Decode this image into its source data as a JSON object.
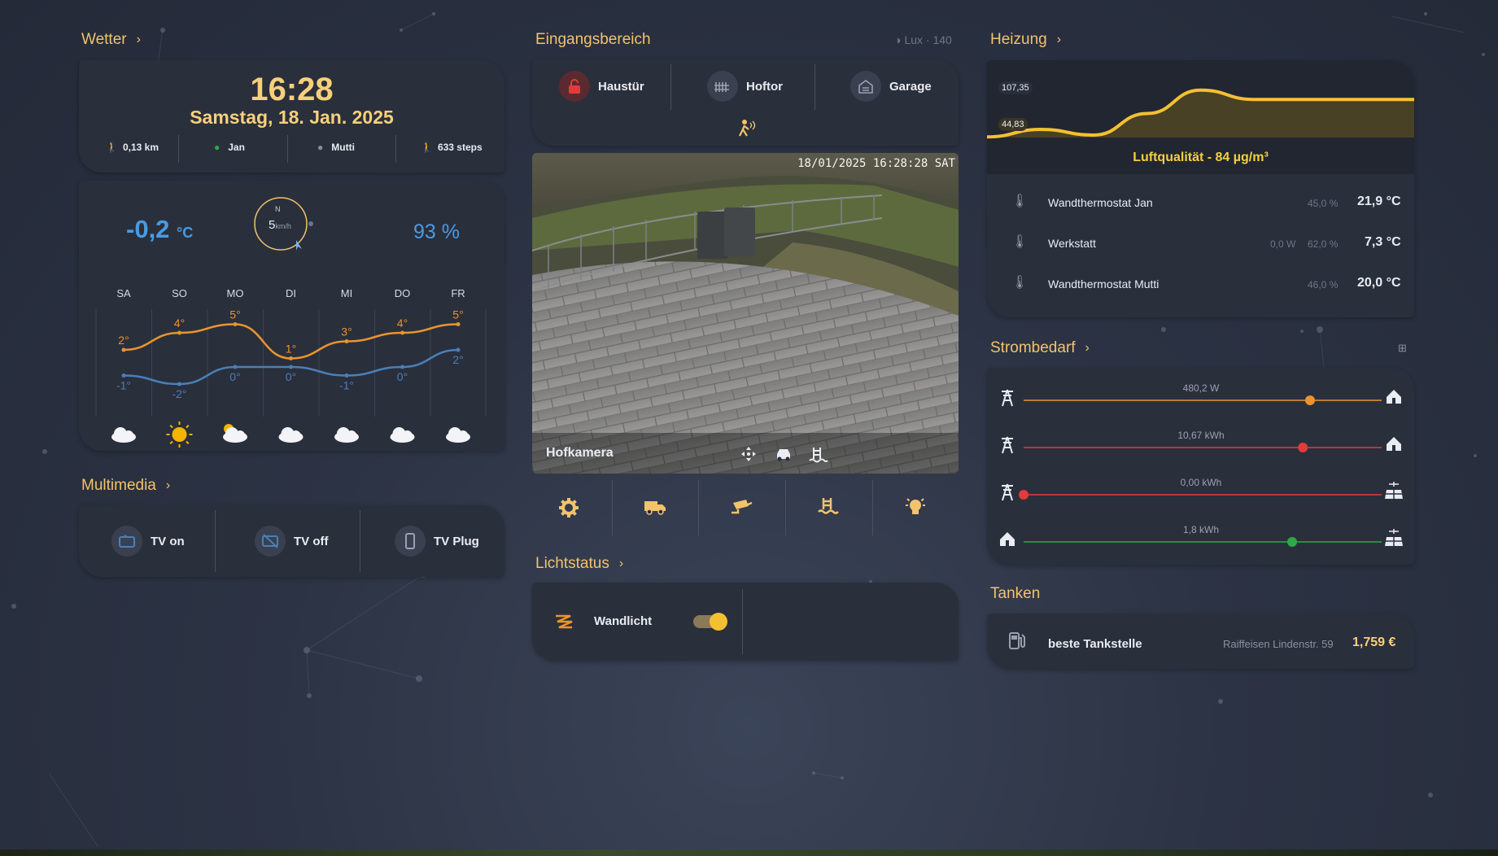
{
  "weather": {
    "section_title": "Wetter",
    "time": "16:28",
    "date": "Samstag, 18. Jan. 2025",
    "stats": [
      {
        "icon": "walking-icon",
        "label": "0,13 km"
      },
      {
        "icon": "person-icon",
        "label": "Jan",
        "color": "#2ea84a"
      },
      {
        "icon": "person-icon",
        "label": "Mutti",
        "color": "#8a8f99"
      },
      {
        "icon": "walking-icon",
        "label": "633 steps"
      }
    ],
    "temperature": "-0,2",
    "temperature_unit": "°C",
    "wind_speed": "5",
    "wind_unit": "km/h",
    "compass_n": "N",
    "humidity": "93 %",
    "chart_data": {
      "type": "line",
      "categories": [
        "SA",
        "SO",
        "MO",
        "DI",
        "MI",
        "DO",
        "FR"
      ],
      "series": [
        {
          "values": [
            2,
            4,
            5,
            1,
            3,
            4,
            5
          ],
          "color": "#e8952e"
        },
        {
          "values": [
            -1,
            -2,
            0,
            0,
            -1,
            0,
            2
          ],
          "color": "#4a7fb8"
        }
      ],
      "high_labels": [
        "2°",
        "4°",
        "5°",
        "1°",
        "3°",
        "4°",
        "5°"
      ],
      "low_labels": [
        "-1°",
        "-2°",
        "0°",
        "0°",
        "-1°",
        "0°",
        "2°"
      ],
      "icons": [
        "cloud-icon",
        "sun-icon",
        "partly-cloudy-icon",
        "cloud-icon",
        "cloud-icon",
        "cloud-icon",
        "cloud-icon"
      ]
    }
  },
  "multimedia": {
    "section_title": "Multimedia",
    "items": [
      {
        "icon": "tv-icon",
        "label": "TV on",
        "icon_color": "#4a7fb8"
      },
      {
        "icon": "tv-off-icon",
        "label": "TV off",
        "icon_color": "#4a7fb8"
      },
      {
        "icon": "phone-icon",
        "label": "TV Plug",
        "icon_color": "#9aa1ad"
      }
    ]
  },
  "entrance": {
    "section_title": "Eingangsbereich",
    "lux": "Lux · 140",
    "doors": [
      {
        "icon": "unlocked-icon",
        "label": "Haustür",
        "icon_color": "#e23b3b"
      },
      {
        "icon": "gate-icon",
        "label": "Hoftor",
        "icon_color": "#9aa1ad"
      },
      {
        "icon": "garage-icon",
        "label": "Garage",
        "icon_color": "#9aa1ad"
      }
    ],
    "motion_icon": "motion-icon",
    "camera": {
      "timestamp": "18/01/2025 16:28:28 SAT",
      "label": "Hofkamera",
      "controls": [
        "move-icon",
        "car-icon",
        "pool-icon"
      ]
    },
    "quick_buttons": [
      "gear-icon",
      "truck-icon",
      "cctv-icon",
      "pool-icon",
      "bulb-icon"
    ]
  },
  "light_status": {
    "section_title": "Lichtstatus",
    "item_label": "Wandlicht",
    "item_icon": "led-strip-icon",
    "toggle_on": true
  },
  "heating": {
    "section_title": "Heizung",
    "chart_data": {
      "type": "area",
      "labels": [
        "107,35",
        "44,83"
      ],
      "color": "#f4c033",
      "values": [
        50,
        58,
        52,
        75,
        100,
        90,
        90,
        90,
        90
      ]
    },
    "air_quality": "Luftqualität - 84 µg/m³",
    "thermostats": [
      {
        "name": "Wandthermostat Jan",
        "power": "",
        "humidity": "45,0 %",
        "temp": "21,9 °C"
      },
      {
        "name": "Werkstatt",
        "power": "0,0 W",
        "humidity": "62,0 %",
        "temp": "7,3 °C"
      },
      {
        "name": "Wandthermostat Mutti",
        "power": "",
        "humidity": "46,0 %",
        "temp": "20,0 °C"
      }
    ]
  },
  "power": {
    "section_title": "Strombedarf",
    "flows": [
      {
        "value": "480,2 W",
        "left_icon": "power-pylon-icon",
        "right_icon": "home-icon",
        "color": "#e8952e",
        "fraction": 0.8
      },
      {
        "value": "10,67 kWh",
        "left_icon": "power-pylon-icon",
        "right_icon": "home-icon",
        "color": "#e23b3b",
        "fraction": 0.78
      },
      {
        "value": "0,00 kWh",
        "left_icon": "power-pylon-icon",
        "right_icon": "solar-panel-icon",
        "color": "#e23b3b",
        "fraction": 0.0
      },
      {
        "value": "1,8 kWh",
        "left_icon": "home-icon",
        "right_icon": "solar-panel-icon",
        "color": "#2ea84a",
        "fraction": 0.75
      }
    ]
  },
  "fuel": {
    "section_title": "Tanken",
    "label": "beste Tankstelle",
    "station": "Raiffeisen Lindenstr. 59",
    "price": "1,759 €"
  }
}
